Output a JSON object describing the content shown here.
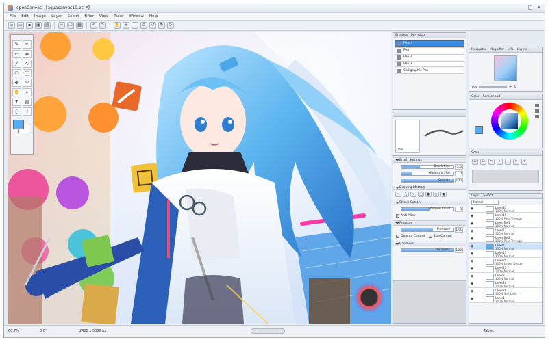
{
  "window": {
    "title": "openCanvas - [aquacanvas10.oci *]",
    "controls": [
      "–",
      "□",
      "✕"
    ]
  },
  "menu": [
    "File",
    "Edit",
    "Image",
    "Layer",
    "Select",
    "Filter",
    "View",
    "Ruler",
    "Window",
    "Help"
  ],
  "toolbar": {
    "icons": [
      "new-file-icon",
      "open-file-icon",
      "save-icon",
      "save-as-icon",
      "print-icon",
      "cut-icon",
      "copy-icon",
      "paste-icon",
      "undo-icon",
      "redo-icon",
      "hand-icon",
      "zoom-in-icon",
      "zoom-out-icon",
      "zoom-fit-icon",
      "rotate-left-icon",
      "rotate-right-icon",
      "rotate-reset-icon"
    ]
  },
  "brushes_panel": {
    "tabs": [
      "Brushes",
      "Pen Atlas"
    ],
    "items": [
      {
        "label": "Pencil",
        "selected": true
      },
      {
        "label": "Pen",
        "selected": false
      },
      {
        "label": "Pen 2",
        "selected": false
      },
      {
        "label": "Pen 3",
        "selected": false
      },
      {
        "label": "Calligraphic Pen",
        "selected": false
      }
    ],
    "preview_size": "25%"
  },
  "brush_settings": {
    "title": "Brush Settings",
    "sliders": [
      {
        "label": "Brush Size",
        "value": "3.0",
        "fill": 0.35
      },
      {
        "label": "Minimum Size",
        "value": "0",
        "fill": 0.2
      },
      {
        "label": "Opacity",
        "value": "100",
        "fill": 1.0
      }
    ],
    "drawing_method": "Drawing Method",
    "stroke_option": "Stroke Option",
    "stroke_slider": {
      "label": "Sharpen Level",
      "value": "0",
      "fill": 0.55
    },
    "antialias": "Anti-Alias",
    "pressure": "Pressure",
    "pressure_slider": {
      "label": "Pressure",
      "value": "1.00",
      "fill": 0.6
    },
    "opacity_control": "Opacity Control",
    "size_control": "Size Control",
    "hardness": "Hardness",
    "hardness_slider": {
      "label": "Hardness",
      "value": "100",
      "fill": 1.0
    }
  },
  "navigator": {
    "tabs": [
      "Navigator",
      "Magnifier",
      "Info",
      "Layers"
    ],
    "zoom": "25%"
  },
  "color_panel": {
    "tabs": [
      "Color",
      "Scratchpad"
    ]
  },
  "scale_panel": {
    "title": "Scale"
  },
  "layers_panel": {
    "tabs": [
      "Layer",
      "Select"
    ],
    "blend": "Normal",
    "rows": [
      {
        "name": "Layer31",
        "mode": "100% Normal",
        "selected": false
      },
      {
        "name": "Layer19",
        "mode": "100% Pass Through",
        "selected": false
      },
      {
        "name": "Layer Set3",
        "mode": "100% Normal",
        "selected": false
      },
      {
        "name": "Layer17",
        "mode": "100% Normal",
        "selected": false
      },
      {
        "name": "Layer Set2",
        "mode": "100% Pass Through",
        "selected": false
      },
      {
        "name": "Layer13",
        "mode": "100% Normal",
        "selected": true
      },
      {
        "name": "Layer15",
        "mode": "100% Normal",
        "selected": false
      },
      {
        "name": "Layer25",
        "mode": "100% Linear Dodge",
        "selected": false
      },
      {
        "name": "Layer23",
        "mode": "100% Normal",
        "selected": false
      },
      {
        "name": "Layer27",
        "mode": "100% Normal",
        "selected": false
      },
      {
        "name": "Layer20",
        "mode": "100% Normal",
        "selected": false
      },
      {
        "name": "Layer28",
        "mode": "100% Soft Light",
        "selected": false
      },
      {
        "name": "Layer1",
        "mode": "100% Normal",
        "selected": false
      }
    ],
    "footer": "Tablet"
  },
  "status": {
    "zoom": "66.7%",
    "angle": "0.0°",
    "size": "2480 x 3508 px"
  },
  "colors": {
    "accent": "#3d8be0",
    "fg_swatch": "#5aaaf0",
    "bg_swatch": "#ffffff"
  }
}
